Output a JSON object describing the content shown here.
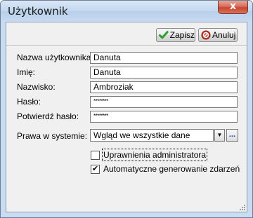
{
  "window": {
    "title": "Użytkownik",
    "close_glyph": "x"
  },
  "toolbar": {
    "save_label": "Zapisz",
    "save_icon": "checkmark-icon",
    "cancel_label": "Anuluj",
    "cancel_icon": "cancel-circle-icon"
  },
  "form": {
    "username_label": "Nazwa użytkownika:",
    "username_value": "Danuta",
    "firstname_label": "Imię:",
    "firstname_value": "Danuta",
    "lastname_label": "Nazwisko:",
    "lastname_value": "Ambroziak",
    "password_label": "Hasło:",
    "password_value": "********",
    "password_confirm_label": "Potwierdź hasło:",
    "password_confirm_value": "********",
    "rights_label": "Prawa w systemie:",
    "rights_value": "Wgląd we wszystkie dane",
    "rights_dropdown_glyph": "▼",
    "rights_more_glyph": "...",
    "admin_label": "Uprawnienia administratora",
    "admin_checked": false,
    "autoevents_label": "Automatyczne generowanie zdarzeń",
    "autoevents_checked": true,
    "check_glyph": "✔"
  },
  "colors": {
    "frame": "#c9dcf1",
    "client": "#f0f0f0",
    "close_button": "#c7462f",
    "save_icon": "#2e9b2e",
    "cancel_icon": "#c8342a"
  }
}
